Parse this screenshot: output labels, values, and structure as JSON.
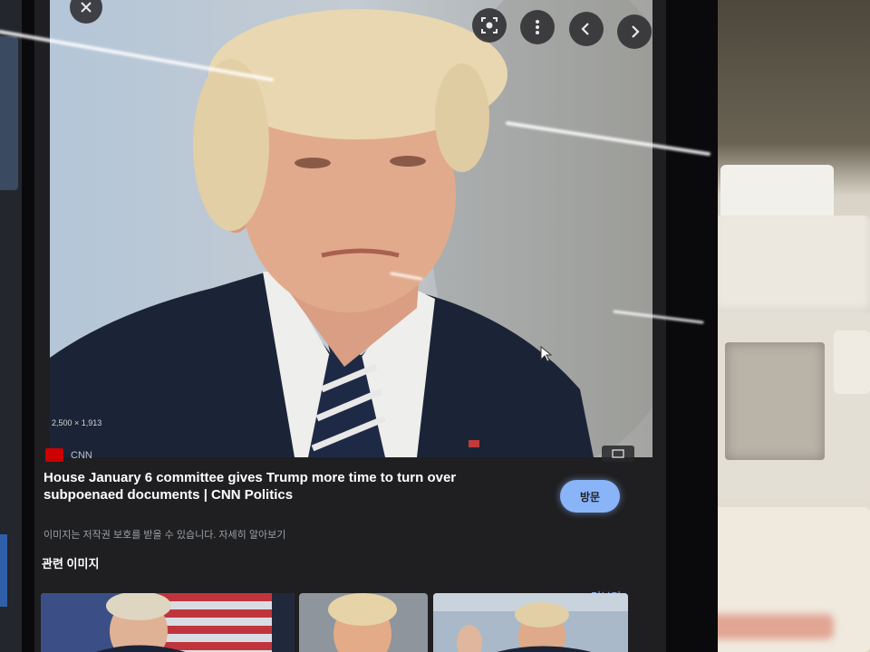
{
  "viewer": {
    "close_icon": "close-icon",
    "toolbar": [
      {
        "icon": "lens-icon"
      },
      {
        "icon": "more-vert-icon"
      },
      {
        "icon": "chevron-left-icon"
      },
      {
        "icon": "chevron-right-icon"
      }
    ],
    "image_dimensions": "2,500 × 1,913",
    "source": {
      "name": "CNN",
      "favicon_color": "#cc0000"
    },
    "title": "House January 6 committee gives Trump more time to turn over subpoenaed documents | CNN Politics",
    "notice": "이미지는 저작권 보호를 받을 수 있습니다. 자세히 알아보기",
    "visit_button": "방문",
    "related_heading": "관련 이미지",
    "see_more": "더보기",
    "colors": {
      "panel": "#1f1f21",
      "accent": "#8ab4f8",
      "text": "#ffffff",
      "muted": "#9aa0a6"
    }
  }
}
